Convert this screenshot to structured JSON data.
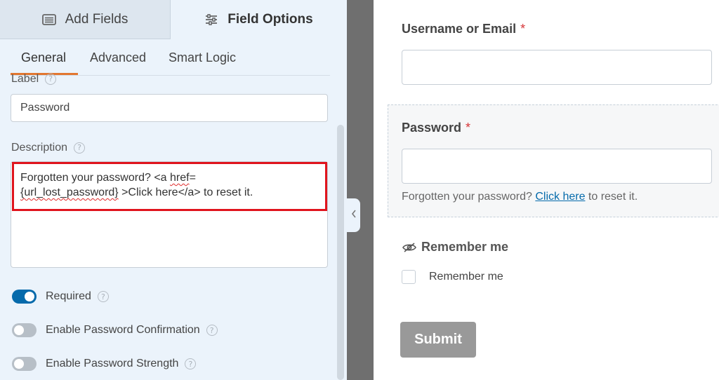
{
  "left_panel": {
    "tabs": {
      "add_fields": "Add Fields",
      "field_options": "Field Options"
    },
    "subtabs": {
      "general": "General",
      "advanced": "Advanced",
      "smart_logic": "Smart Logic"
    },
    "label_field": {
      "label": "Label",
      "value": "Password",
      "help": "?"
    },
    "description_field": {
      "label": "Description",
      "help": "?",
      "line1_pre": "Forgotten your password? <a ",
      "line1_sq": "href",
      "line1_post": "=",
      "line2_sq": "{url_lost_password}",
      "line2_post": " >Click here</a> to reset it."
    },
    "toggles": {
      "required": {
        "label": "Required",
        "on": true
      },
      "password_confirmation": {
        "label": "Enable Password Confirmation",
        "on": false
      },
      "password_strength": {
        "label": "Enable Password Strength",
        "on": false
      }
    }
  },
  "form": {
    "username": {
      "label": "Username or Email",
      "required_mark": "*"
    },
    "password": {
      "label": "Password",
      "required_mark": "*",
      "desc_pre": "Forgotten your password? ",
      "desc_link": "Click here",
      "desc_post": " to reset it."
    },
    "remember": {
      "section_label": "Remember me",
      "checkbox_label": "Remember me",
      "icon": "eye-slash-icon"
    },
    "submit_label": "Submit"
  },
  "colors": {
    "panel_bg": "#ebf3fb",
    "accent_orange": "#e27730",
    "toggle_on": "#056aab",
    "highlight": "#e0141d",
    "required_red": "#d63638",
    "link_blue": "#056aab"
  }
}
